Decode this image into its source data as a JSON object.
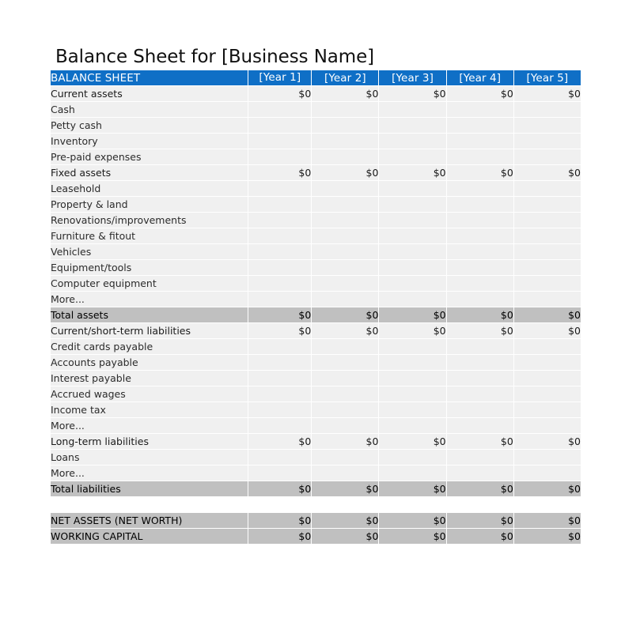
{
  "document": {
    "title": "Balance Sheet for [Business Name]"
  },
  "colors": {
    "header_blue": "#0f6fc6",
    "header_blue_last": "#0d3e6e",
    "cell_gray": "#f0f0f0",
    "total_gray": "#c0c0c0",
    "white": "#ffffff",
    "text": "#1a1a1a"
  },
  "table": {
    "columns": [
      {
        "key": "label",
        "label": "BALANCE SHEET",
        "align": "left"
      },
      {
        "key": "y1",
        "label": "[Year 1]",
        "align": "center"
      },
      {
        "key": "y2",
        "label": "[Year 2]",
        "align": "center"
      },
      {
        "key": "y3",
        "label": "[Year 3]",
        "align": "center"
      },
      {
        "key": "y4",
        "label": "[Year 4]",
        "align": "center"
      },
      {
        "key": "y5",
        "label": "[Year 5]",
        "align": "center"
      }
    ],
    "zero": "$0",
    "blank": "",
    "rows": [
      {
        "type": "section",
        "label": "Current assets",
        "values": [
          "$0",
          "$0",
          "$0",
          "$0",
          "$0"
        ]
      },
      {
        "type": "detail",
        "label": "Cash",
        "values": [
          "",
          "",
          "",
          "",
          ""
        ]
      },
      {
        "type": "detail",
        "label": "Petty cash",
        "values": [
          "",
          "",
          "",
          "",
          ""
        ]
      },
      {
        "type": "detail",
        "label": "Inventory",
        "values": [
          "",
          "",
          "",
          "",
          ""
        ]
      },
      {
        "type": "detail",
        "label": "Pre-paid expenses",
        "values": [
          "",
          "",
          "",
          "",
          ""
        ]
      },
      {
        "type": "section",
        "label": "Fixed assets",
        "values": [
          "$0",
          "$0",
          "$0",
          "$0",
          "$0"
        ]
      },
      {
        "type": "detail",
        "label": "Leasehold",
        "values": [
          "",
          "",
          "",
          "",
          ""
        ]
      },
      {
        "type": "detail",
        "label": "Property & land",
        "values": [
          "",
          "",
          "",
          "",
          ""
        ]
      },
      {
        "type": "detail",
        "label": "Renovations/improvements",
        "values": [
          "",
          "",
          "",
          "",
          ""
        ]
      },
      {
        "type": "detail",
        "label": "Furniture & fitout",
        "values": [
          "",
          "",
          "",
          "",
          ""
        ]
      },
      {
        "type": "detail",
        "label": "Vehicles",
        "values": [
          "",
          "",
          "",
          "",
          ""
        ]
      },
      {
        "type": "detail",
        "label": "Equipment/tools",
        "values": [
          "",
          "",
          "",
          "",
          ""
        ]
      },
      {
        "type": "detail",
        "label": "Computer equipment",
        "values": [
          "",
          "",
          "",
          "",
          ""
        ]
      },
      {
        "type": "detail",
        "label": "More...",
        "values": [
          "",
          "",
          "",
          "",
          ""
        ]
      },
      {
        "type": "total",
        "label": "Total assets",
        "values": [
          "$0",
          "$0",
          "$0",
          "$0",
          "$0"
        ]
      },
      {
        "type": "section",
        "label": "Current/short-term liabilities",
        "values": [
          "$0",
          "$0",
          "$0",
          "$0",
          "$0"
        ]
      },
      {
        "type": "detail",
        "label": "Credit cards payable",
        "values": [
          "",
          "",
          "",
          "",
          ""
        ]
      },
      {
        "type": "detail",
        "label": "Accounts payable",
        "values": [
          "",
          "",
          "",
          "",
          ""
        ]
      },
      {
        "type": "detail",
        "label": "Interest payable",
        "values": [
          "",
          "",
          "",
          "",
          ""
        ]
      },
      {
        "type": "detail",
        "label": "Accrued wages",
        "values": [
          "",
          "",
          "",
          "",
          ""
        ]
      },
      {
        "type": "detail",
        "label": "Income tax",
        "values": [
          "",
          "",
          "",
          "",
          ""
        ]
      },
      {
        "type": "detail",
        "label": "More...",
        "values": [
          "",
          "",
          "",
          "",
          ""
        ]
      },
      {
        "type": "section",
        "label": "Long-term liabilities",
        "values": [
          "$0",
          "$0",
          "$0",
          "$0",
          "$0"
        ]
      },
      {
        "type": "detail",
        "label": "Loans",
        "values": [
          "",
          "",
          "",
          "",
          ""
        ]
      },
      {
        "type": "detail",
        "label": "More...",
        "values": [
          "",
          "",
          "",
          "",
          ""
        ]
      },
      {
        "type": "total",
        "label": "Total liabilities",
        "values": [
          "$0",
          "$0",
          "$0",
          "$0",
          "$0"
        ]
      },
      {
        "type": "spacer",
        "label": "",
        "values": [
          "",
          "",
          "",
          "",
          ""
        ]
      },
      {
        "type": "total",
        "label": "NET ASSETS (NET WORTH)",
        "values": [
          "$0",
          "$0",
          "$0",
          "$0",
          "$0"
        ]
      },
      {
        "type": "total",
        "label": "WORKING CAPITAL",
        "values": [
          "$0",
          "$0",
          "$0",
          "$0",
          "$0"
        ]
      }
    ]
  }
}
